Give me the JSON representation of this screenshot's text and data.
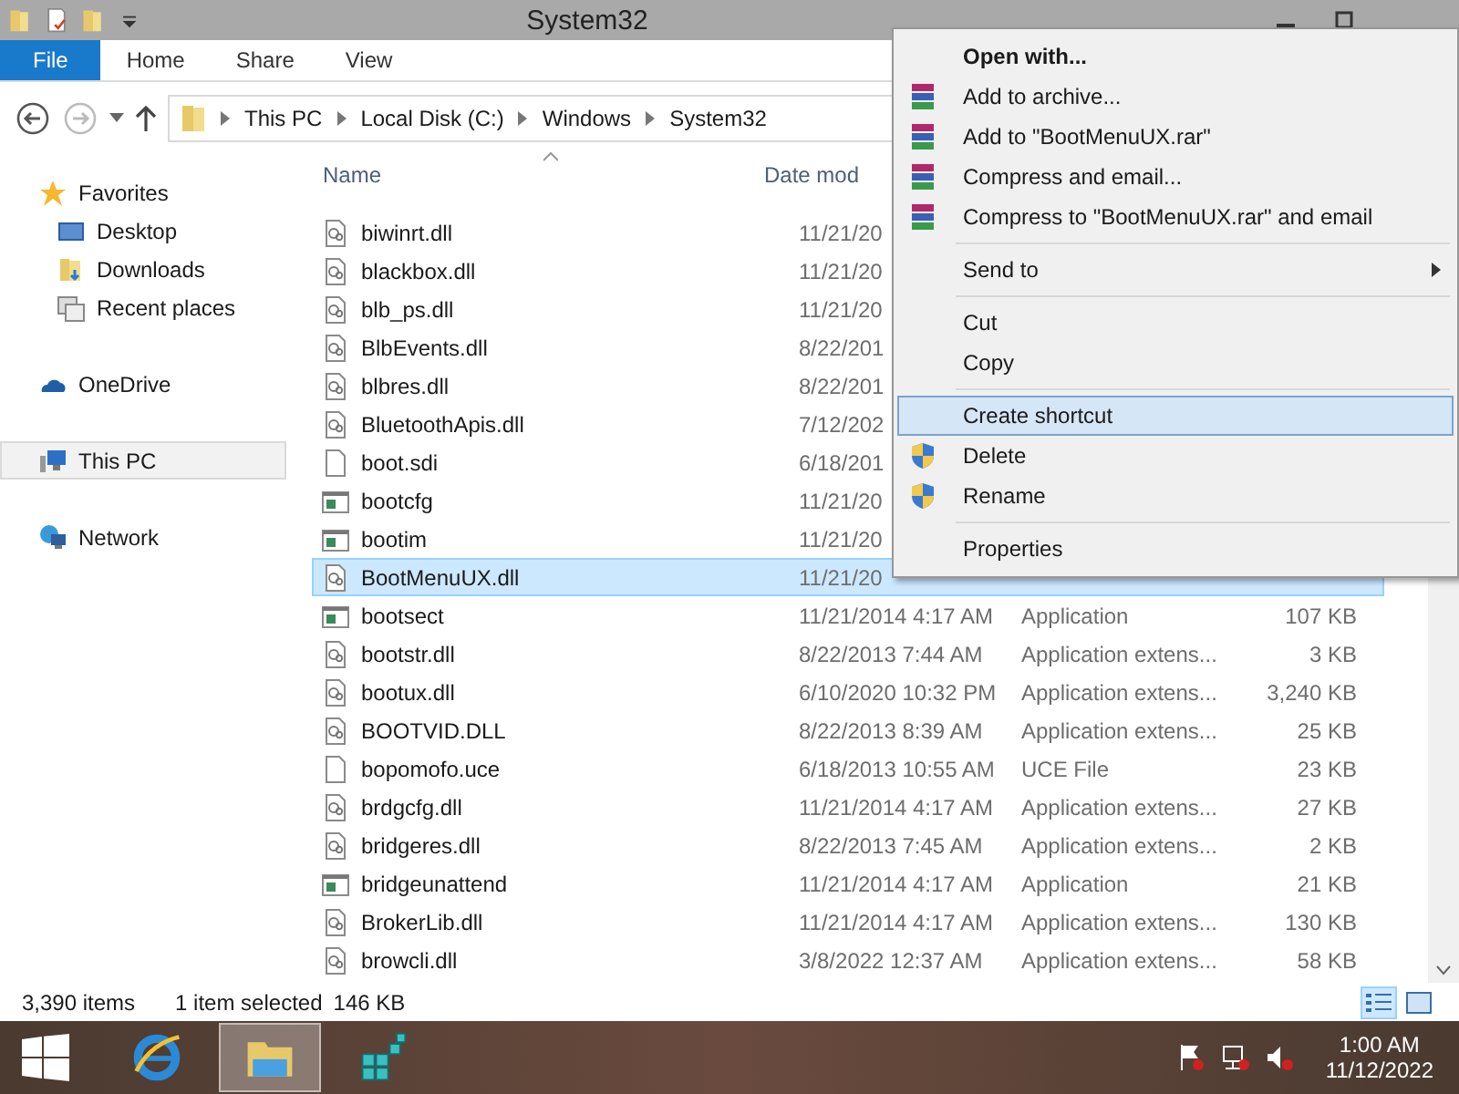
{
  "window": {
    "title": "System32"
  },
  "ribbon_tabs": [
    {
      "label": "File",
      "kind": "file",
      "selected": false
    },
    {
      "label": "Home",
      "kind": "tab",
      "selected": false
    },
    {
      "label": "Share",
      "kind": "tab",
      "selected": false
    },
    {
      "label": "View",
      "kind": "tab",
      "selected": false
    }
  ],
  "breadcrumb": [
    "This PC",
    "Local Disk (C:)",
    "Windows",
    "System32"
  ],
  "sidebar": {
    "items": [
      {
        "label": "Favorites",
        "kind": "star",
        "selected": false,
        "children": [
          {
            "label": "Desktop",
            "kind": "desktop",
            "selected": false
          },
          {
            "label": "Downloads",
            "kind": "downloads",
            "selected": false
          },
          {
            "label": "Recent places",
            "kind": "recent",
            "selected": false
          }
        ]
      },
      {
        "label": "OneDrive",
        "kind": "cloud",
        "selected": false
      },
      {
        "label": "This PC",
        "kind": "pc",
        "selected": true
      },
      {
        "label": "Network",
        "kind": "network",
        "selected": false
      }
    ]
  },
  "table": {
    "columns": [
      "Name",
      "Date mod"
    ],
    "rows": [
      {
        "name": "biwinrt.dll",
        "kind": "dll",
        "date": "11/21/20",
        "selected": false
      },
      {
        "name": "blackbox.dll",
        "kind": "dll",
        "date": "11/21/20",
        "selected": false
      },
      {
        "name": "blb_ps.dll",
        "kind": "dll",
        "date": "11/21/20",
        "selected": false
      },
      {
        "name": "BlbEvents.dll",
        "kind": "dll",
        "date": "8/22/201",
        "selected": false
      },
      {
        "name": "blbres.dll",
        "kind": "dll",
        "date": "8/22/201",
        "selected": false
      },
      {
        "name": "BluetoothApis.dll",
        "kind": "dll",
        "date": "7/12/202",
        "selected": false
      },
      {
        "name": "boot.sdi",
        "kind": "file",
        "date": "6/18/201",
        "selected": false
      },
      {
        "name": "bootcfg",
        "kind": "exe",
        "date": "11/21/20",
        "selected": false
      },
      {
        "name": "bootim",
        "kind": "exe",
        "date": "11/21/20",
        "selected": false
      },
      {
        "name": "BootMenuUX.dll",
        "kind": "dll",
        "date": "11/21/20",
        "selected": true
      },
      {
        "name": "bootsect",
        "kind": "exe",
        "date": "11/21/2014 4:17 AM",
        "type": "Application",
        "size": "107 KB",
        "selected": false
      },
      {
        "name": "bootstr.dll",
        "kind": "dll",
        "date": "8/22/2013 7:44 AM",
        "type": "Application extens...",
        "size": "3 KB",
        "selected": false
      },
      {
        "name": "bootux.dll",
        "kind": "dll",
        "date": "6/10/2020 10:32 PM",
        "type": "Application extens...",
        "size": "3,240 KB",
        "selected": false
      },
      {
        "name": "BOOTVID.DLL",
        "kind": "dll",
        "date": "8/22/2013 8:39 AM",
        "type": "Application extens...",
        "size": "25 KB",
        "selected": false
      },
      {
        "name": "bopomofo.uce",
        "kind": "file",
        "date": "6/18/2013 10:55 AM",
        "type": "UCE File",
        "size": "23 KB",
        "selected": false
      },
      {
        "name": "brdgcfg.dll",
        "kind": "dll",
        "date": "11/21/2014 4:17 AM",
        "type": "Application extens...",
        "size": "27 KB",
        "selected": false
      },
      {
        "name": "bridgeres.dll",
        "kind": "dll",
        "date": "8/22/2013 7:45 AM",
        "type": "Application extens...",
        "size": "2 KB",
        "selected": false
      },
      {
        "name": "bridgeunattend",
        "kind": "exe",
        "date": "11/21/2014 4:17 AM",
        "type": "Application",
        "size": "21 KB",
        "selected": false
      },
      {
        "name": "BrokerLib.dll",
        "kind": "dll",
        "date": "11/21/2014 4:17 AM",
        "type": "Application extens...",
        "size": "130 KB",
        "selected": false
      },
      {
        "name": "browcli.dll",
        "kind": "dll",
        "date": "3/8/2022 12:37 AM",
        "type": "Application extens...",
        "size": "58 KB",
        "selected": false
      }
    ]
  },
  "context_menu": [
    {
      "kind": "plain",
      "label": "Open with...",
      "default": true,
      "selected": false
    },
    {
      "kind": "rar",
      "label": "Add to archive...",
      "default": false,
      "selected": false
    },
    {
      "kind": "rar",
      "label": "Add to \"BootMenuUX.rar\"",
      "default": false,
      "selected": false
    },
    {
      "kind": "rar",
      "label": "Compress and email...",
      "default": false,
      "selected": false
    },
    {
      "kind": "rar",
      "label": "Compress to \"BootMenuUX.rar\" and email",
      "default": false,
      "selected": false
    },
    {
      "kind": "separator"
    },
    {
      "kind": "submenu",
      "label": "Send to",
      "default": false,
      "selected": false
    },
    {
      "kind": "separator"
    },
    {
      "kind": "plain",
      "label": "Cut",
      "default": false,
      "selected": false
    },
    {
      "kind": "plain",
      "label": "Copy",
      "default": false,
      "selected": false
    },
    {
      "kind": "separator"
    },
    {
      "kind": "plain",
      "label": "Create shortcut",
      "default": false,
      "selected": true
    },
    {
      "kind": "shield",
      "label": "Delete",
      "default": false,
      "selected": false
    },
    {
      "kind": "shield",
      "label": "Rename",
      "default": false,
      "selected": false
    },
    {
      "kind": "separator"
    },
    {
      "kind": "plain",
      "label": "Properties",
      "default": false,
      "selected": false
    }
  ],
  "status_bar": {
    "item_count": "3,390 items",
    "selection": "1 item selected",
    "selection_size": "146 KB",
    "views": [
      {
        "kind": "details",
        "selected": true
      },
      {
        "kind": "large",
        "selected": false
      }
    ]
  },
  "taskbar": {
    "apps": [
      {
        "kind": "ie",
        "selected": false
      },
      {
        "kind": "explorer",
        "selected": true
      },
      {
        "kind": "cubes",
        "selected": false
      }
    ],
    "time": "1:00 AM",
    "date": "11/12/2022"
  }
}
